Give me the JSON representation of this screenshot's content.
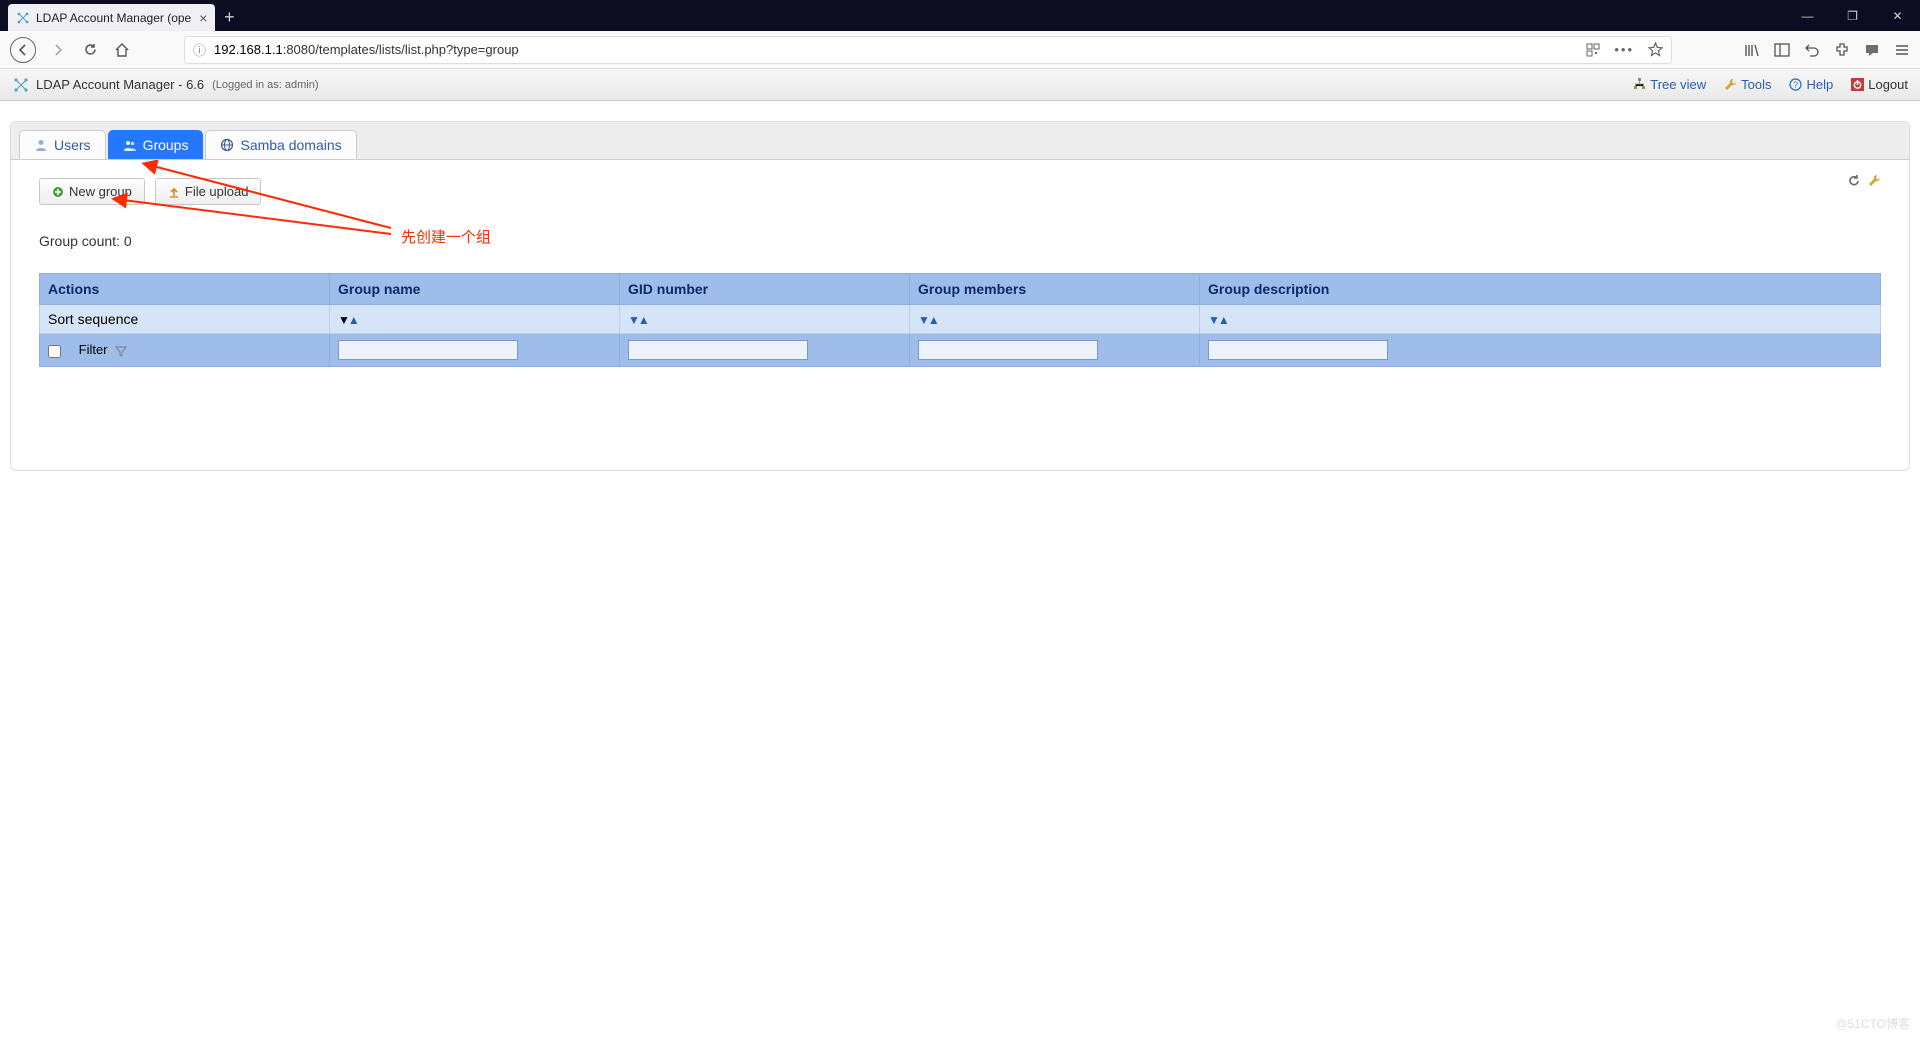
{
  "browser": {
    "tab_title": "LDAP Account Manager (ope",
    "url_info_icon": "ⓘ",
    "url_host": "192.168.1.1",
    "url_rest": ":8080/templates/lists/list.php?type=group"
  },
  "header": {
    "title": "LDAP Account Manager - 6.6",
    "logged_in": "(Logged in as: admin)",
    "links": {
      "treeview": "Tree view",
      "tools": "Tools",
      "help": "Help",
      "logout": "Logout"
    }
  },
  "tabs": {
    "users": "Users",
    "groups": "Groups",
    "samba": "Samba domains"
  },
  "buttons": {
    "new_group": "New group",
    "file_upload": "File upload"
  },
  "count_label": "Group count: 0",
  "annotation": "先创建一个组",
  "table": {
    "headers": {
      "actions": "Actions",
      "group_name": "Group name",
      "gid": "GID number",
      "members": "Group members",
      "description": "Group description"
    },
    "sort_label": "Sort sequence",
    "filter_label": "Filter"
  },
  "watermark": "@51CTO博客"
}
